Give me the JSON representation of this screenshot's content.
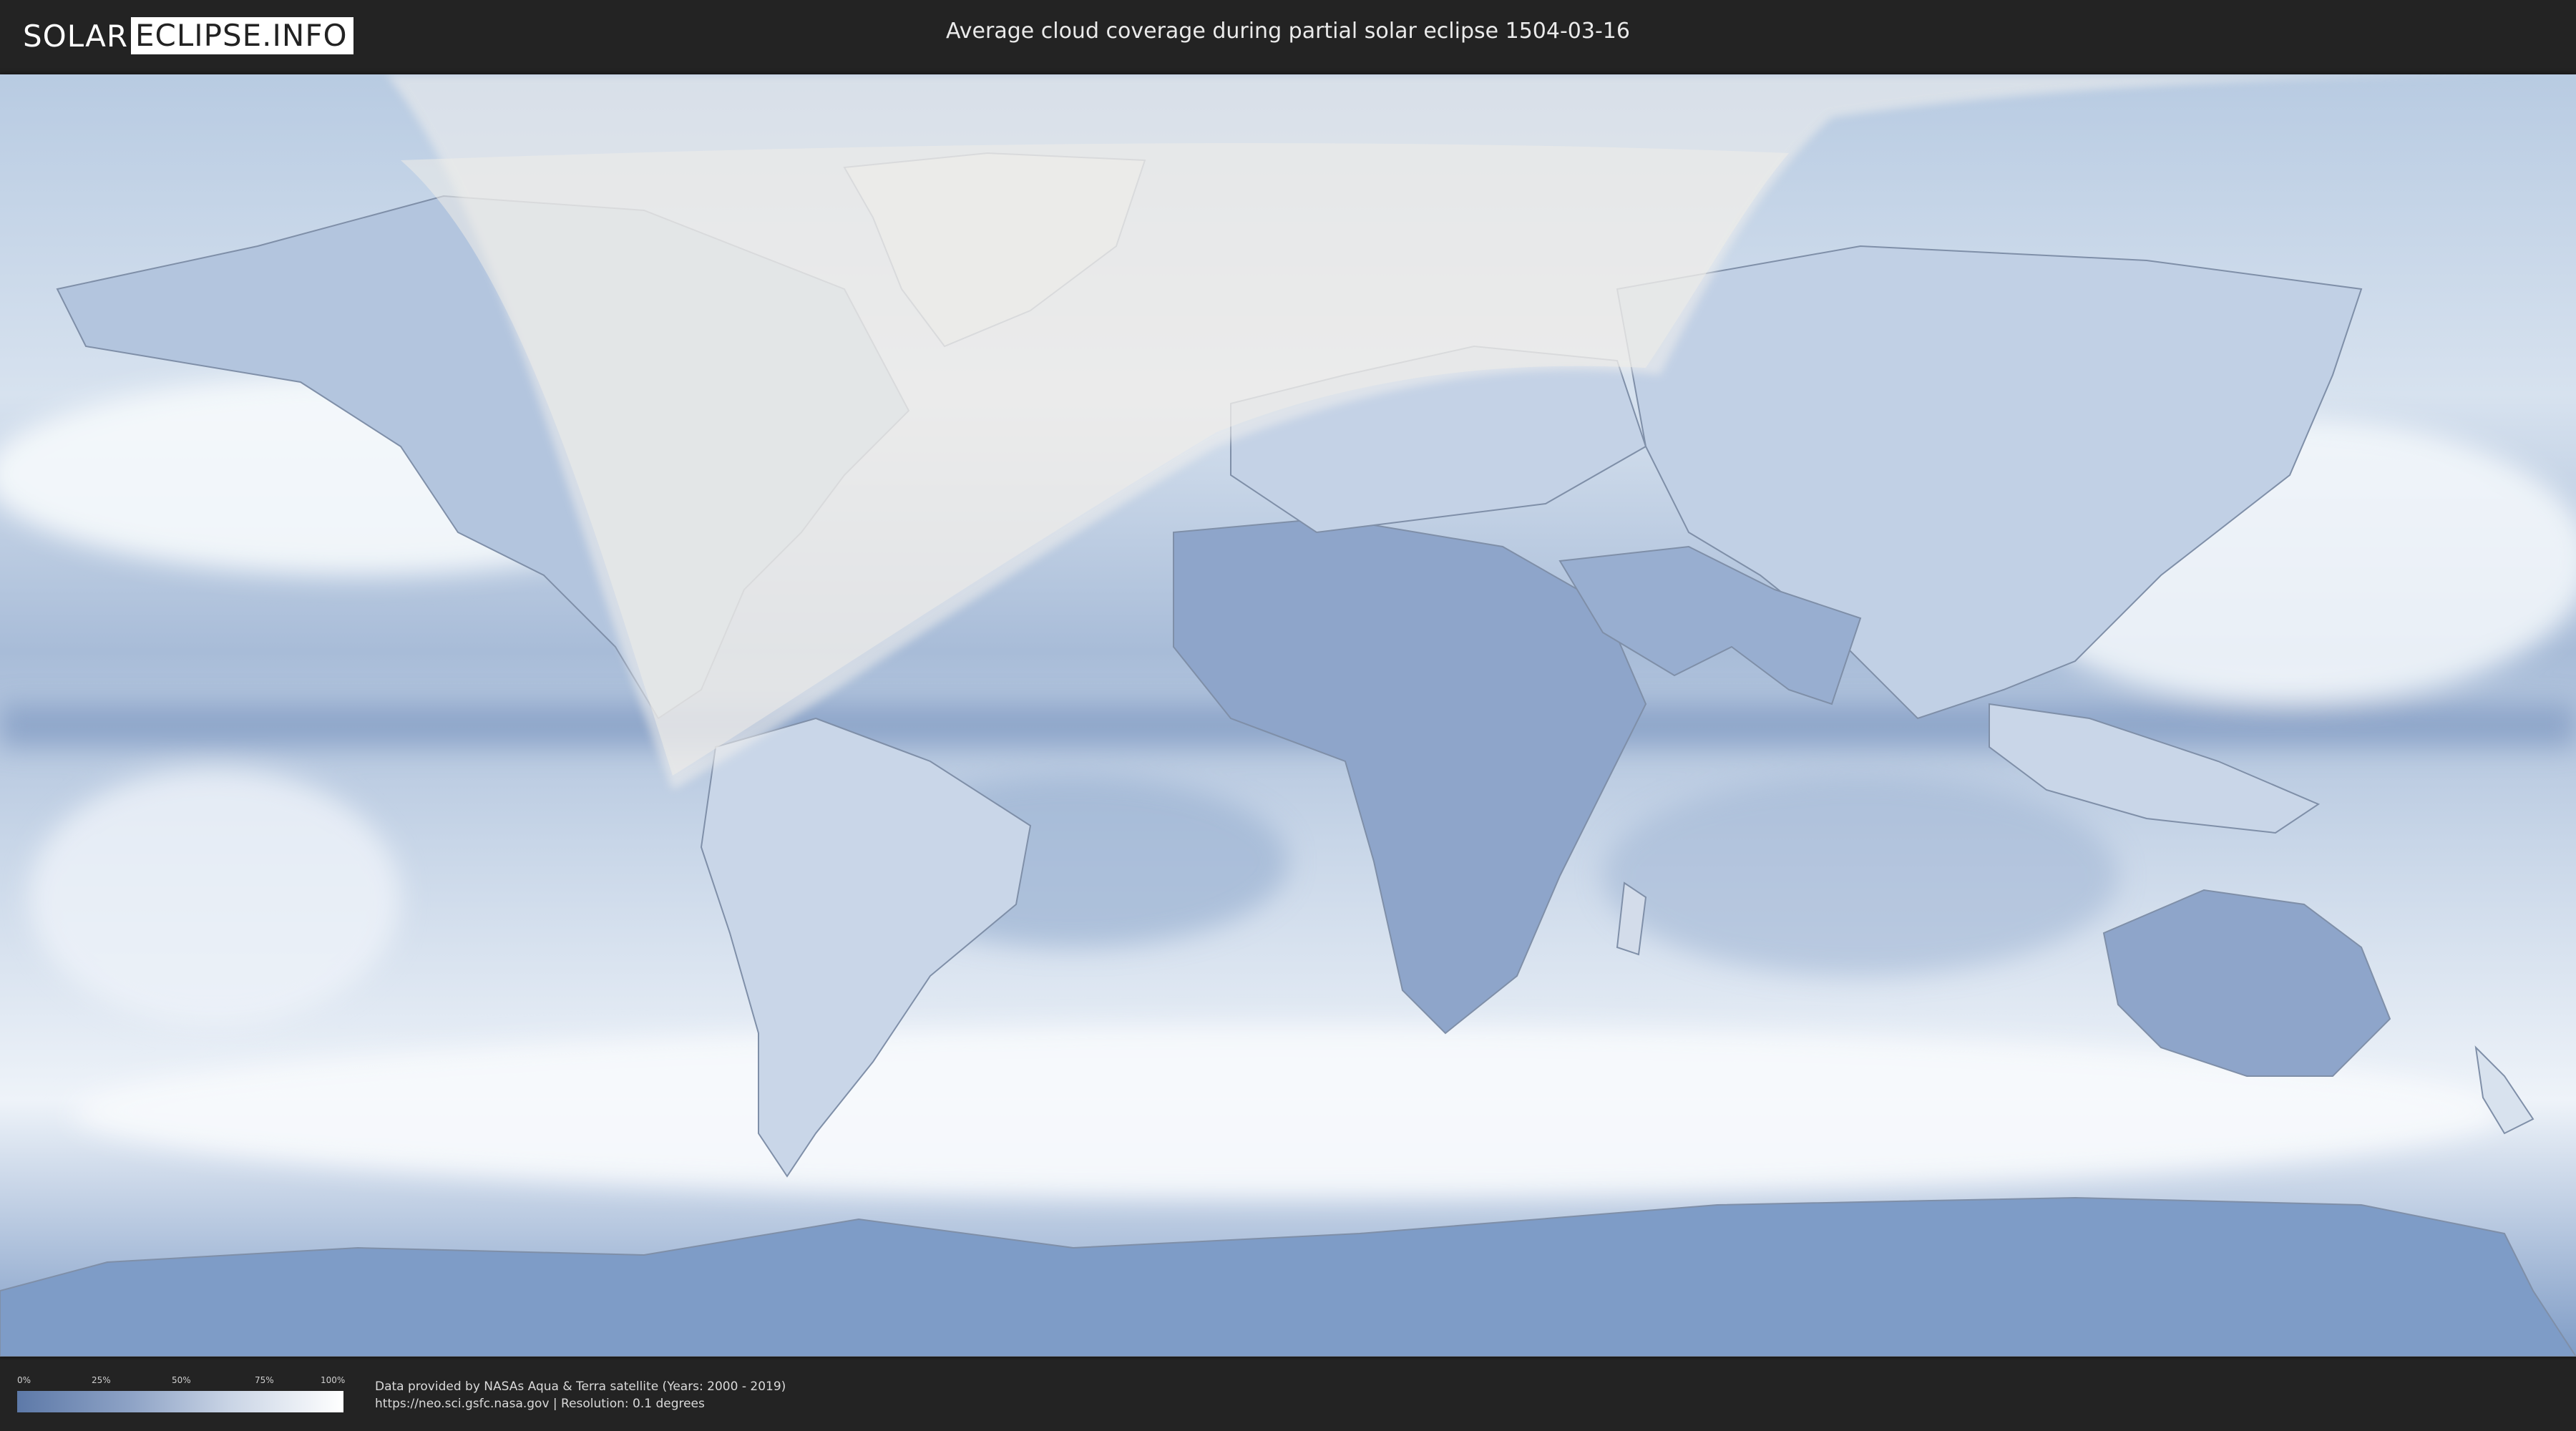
{
  "header": {
    "logo_left": "SOLAR",
    "logo_right": "ECLIPSE.INFO",
    "title": "Average cloud coverage during partial solar eclipse 1504-03-16"
  },
  "map": {
    "colors": {
      "cloud_clear": "#5d79a8",
      "cloud_full": "#ffffff",
      "land_outline": "#7f8fa8",
      "eclipse_overlay": "#f3f1ee"
    }
  },
  "legend": {
    "ticks": [
      "0%",
      "25%",
      "50%",
      "75%",
      "100%"
    ]
  },
  "footer": {
    "credit_line1": "Data provided by NASAs Aqua & Terra satellite (Years: 2000 - 2019)",
    "credit_line2": "https://neo.sci.gsfc.nasa.gov | Resolution: 0.1 degrees"
  }
}
